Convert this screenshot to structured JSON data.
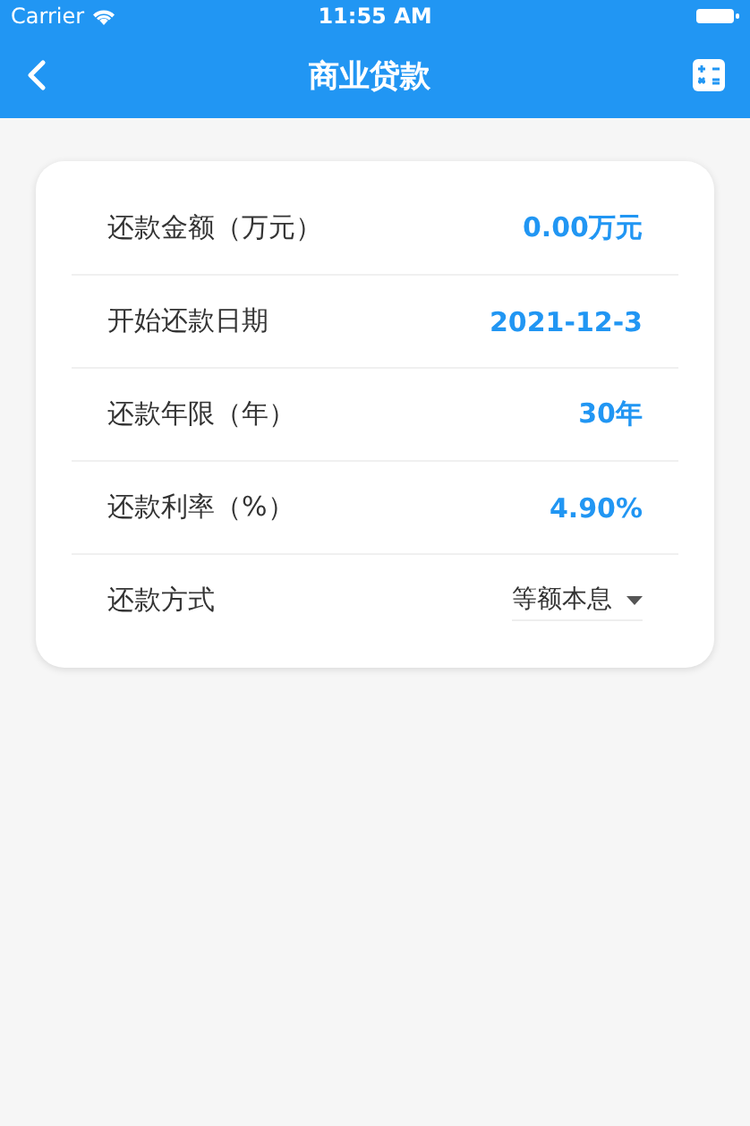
{
  "status_bar": {
    "carrier": "Carrier",
    "time": "11:55 AM"
  },
  "nav_bar": {
    "title": "商业贷款"
  },
  "form": {
    "rows": [
      {
        "kind": "value",
        "label": "还款金额（万元）",
        "value": "0.00万元"
      },
      {
        "kind": "value",
        "label": "开始还款日期",
        "value": "2021-12-3"
      },
      {
        "kind": "value",
        "label": "还款年限（年）",
        "value": "30年"
      },
      {
        "kind": "value",
        "label": "还款利率（%）",
        "value": "4.90%"
      },
      {
        "kind": "dropdown",
        "label": "还款方式",
        "value": "等额本息"
      }
    ]
  }
}
